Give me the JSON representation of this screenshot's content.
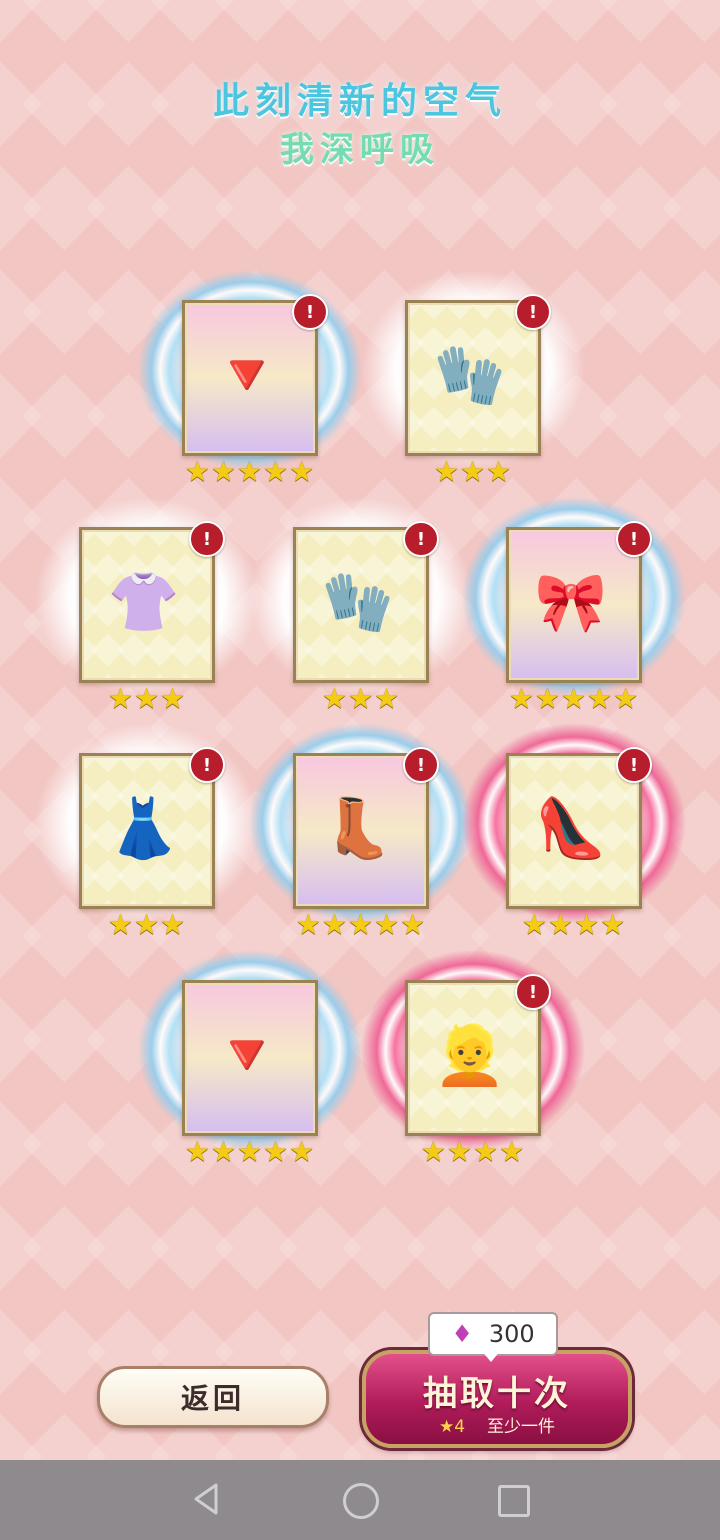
{
  "title": {
    "line1": "此刻清新的空气",
    "line2": "我深呼吸"
  },
  "items": [
    {
      "name": "earrings",
      "stars": "★★★★★",
      "badge": "!",
      "icon": "🔻",
      "rarity": 5
    },
    {
      "name": "gloves",
      "stars": "★★★",
      "badge": "!",
      "icon": "🧤",
      "rarity": 3
    },
    {
      "name": "blouse",
      "stars": "★★★",
      "badge": "!",
      "icon": "👚",
      "rarity": 3
    },
    {
      "name": "gloves-green",
      "stars": "★★★",
      "badge": "!",
      "icon": "🧤",
      "rarity": 3
    },
    {
      "name": "hair-ornament",
      "stars": "★★★★★",
      "badge": "!",
      "icon": "🎀",
      "rarity": 5
    },
    {
      "name": "skirt",
      "stars": "★★★",
      "badge": "!",
      "icon": "👗",
      "rarity": 3
    },
    {
      "name": "boots",
      "stars": "★★★★★",
      "badge": "!",
      "icon": "👢",
      "rarity": 5
    },
    {
      "name": "shoes",
      "stars": "★★★★",
      "badge": "!",
      "icon": "👠",
      "rarity": 4
    },
    {
      "name": "earrings-2",
      "stars": "★★★★★",
      "icon": "🔻",
      "rarity": 5
    },
    {
      "name": "hair-wig",
      "stars": "★★★★",
      "badge": "!",
      "icon": "👱",
      "rarity": 4
    }
  ],
  "buttons": {
    "back_label": "返回",
    "draw_label": "抽取十次",
    "draw_star": "★",
    "draw_min_star": "4",
    "draw_guarantee": "至少一件",
    "cost": "300",
    "cost_icon": "gem-icon"
  },
  "colors": {
    "title1": "#4cc5de",
    "title2": "#74dcb0",
    "draw_button": "#b01c5a",
    "badge": "#b71d2a",
    "star": "#f5cc14"
  }
}
